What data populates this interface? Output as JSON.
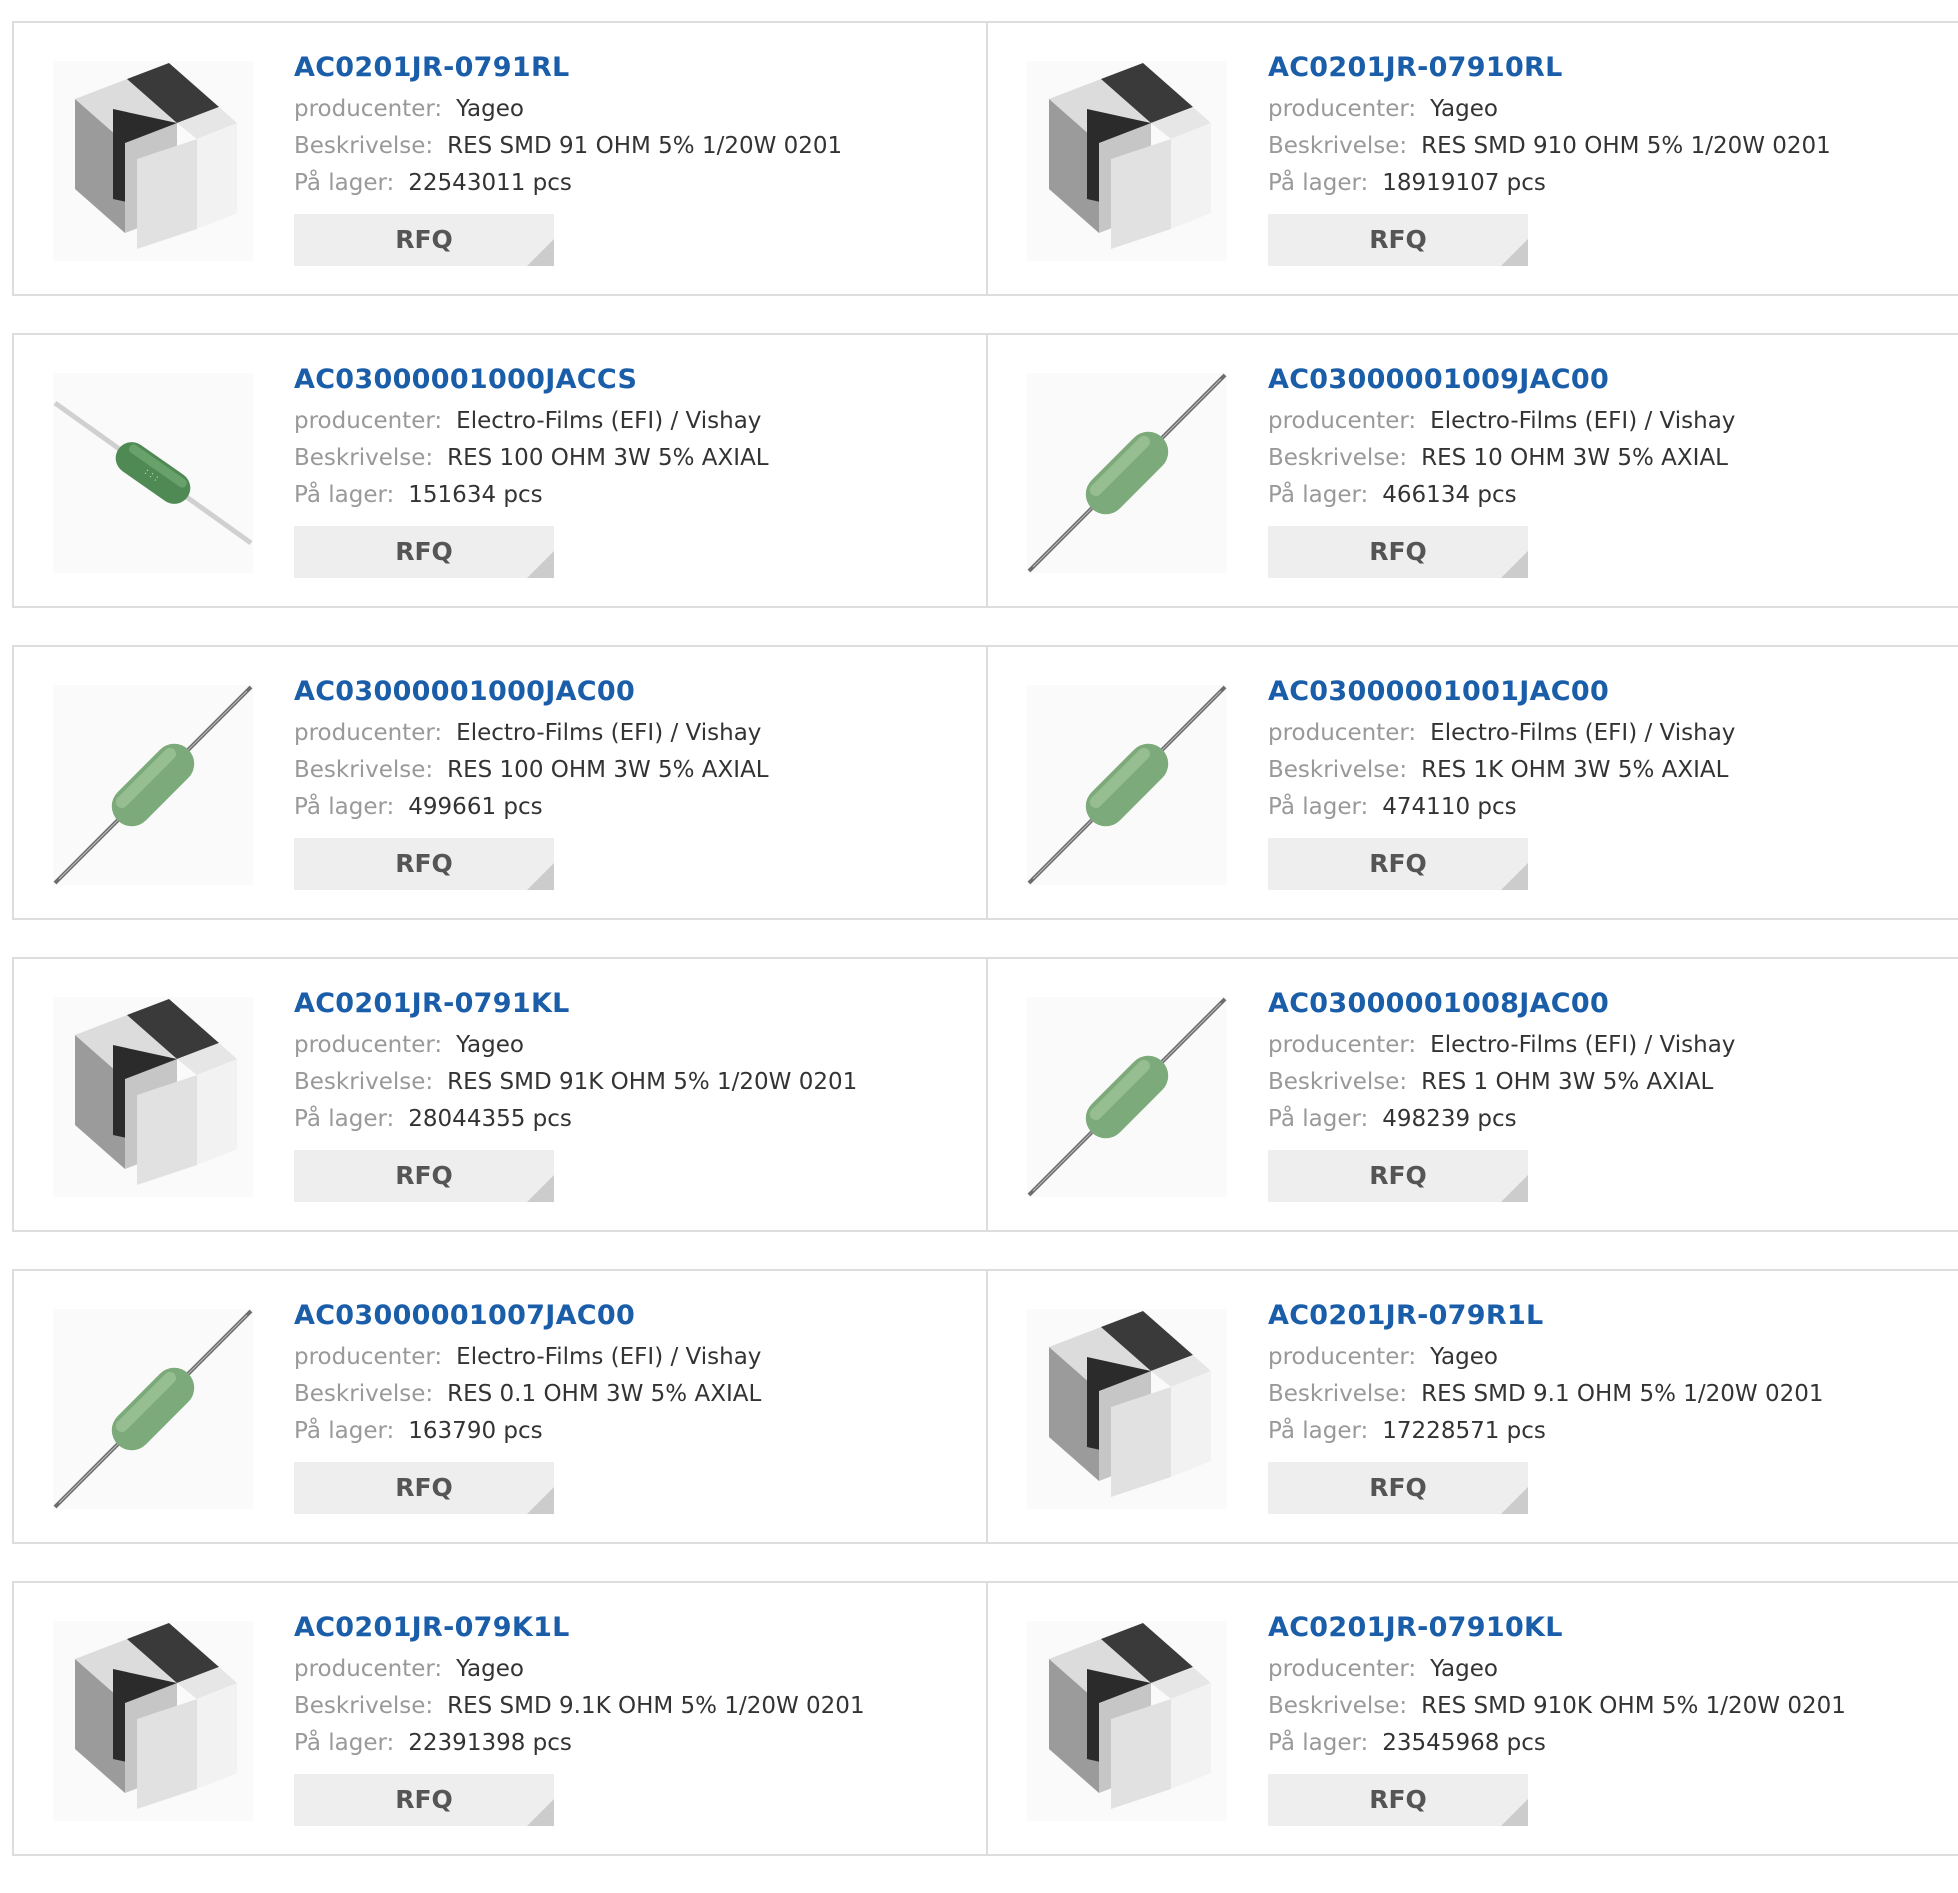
{
  "labels": {
    "manufacturer": "producenter:",
    "description": "Beskrivelse:",
    "stock": "På lager:",
    "rfq": "RFQ"
  },
  "colors": {
    "part_link": "#1a5da8",
    "label": "#999999",
    "value": "#333333",
    "rfq_bg": "#eeeeee",
    "border": "#dddddd"
  },
  "products": [
    {
      "part": "AC0201JR-0791RL",
      "manufacturer": "Yageo",
      "description": "RES SMD 91 OHM 5% 1/20W 0201",
      "stock": "22543011 pcs",
      "image": "chip-resistor-icon"
    },
    {
      "part": "AC0201JR-07910RL",
      "manufacturer": "Yageo",
      "description": "RES SMD 910 OHM 5% 1/20W 0201",
      "stock": "18919107 pcs",
      "image": "chip-resistor-icon"
    },
    {
      "part": "AC03000001000JACCS",
      "manufacturer": "Electro-Films (EFI) / Vishay",
      "description": "RES 100 OHM 3W 5% AXIAL",
      "stock": "151634 pcs",
      "image": "axial-resistor-light-icon"
    },
    {
      "part": "AC03000001009JAC00",
      "manufacturer": "Electro-Films (EFI) / Vishay",
      "description": "RES 10 OHM 3W 5% AXIAL",
      "stock": "466134 pcs",
      "image": "axial-resistor-icon"
    },
    {
      "part": "AC03000001000JAC00",
      "manufacturer": "Electro-Films (EFI) / Vishay",
      "description": "RES 100 OHM 3W 5% AXIAL",
      "stock": "499661 pcs",
      "image": "axial-resistor-icon"
    },
    {
      "part": "AC03000001001JAC00",
      "manufacturer": "Electro-Films (EFI) / Vishay",
      "description": "RES 1K OHM 3W 5% AXIAL",
      "stock": "474110 pcs",
      "image": "axial-resistor-icon"
    },
    {
      "part": "AC0201JR-0791KL",
      "manufacturer": "Yageo",
      "description": "RES SMD 91K OHM 5% 1/20W 0201",
      "stock": "28044355 pcs",
      "image": "chip-resistor-icon"
    },
    {
      "part": "AC03000001008JAC00",
      "manufacturer": "Electro-Films (EFI) / Vishay",
      "description": "RES 1 OHM 3W 5% AXIAL",
      "stock": "498239 pcs",
      "image": "axial-resistor-icon"
    },
    {
      "part": "AC03000001007JAC00",
      "manufacturer": "Electro-Films (EFI) / Vishay",
      "description": "RES 0.1 OHM 3W 5% AXIAL",
      "stock": "163790 pcs",
      "image": "axial-resistor-icon"
    },
    {
      "part": "AC0201JR-079R1L",
      "manufacturer": "Yageo",
      "description": "RES SMD 9.1 OHM 5% 1/20W 0201",
      "stock": "17228571 pcs",
      "image": "chip-resistor-icon"
    },
    {
      "part": "AC0201JR-079K1L",
      "manufacturer": "Yageo",
      "description": "RES SMD 9.1K OHM 5% 1/20W 0201",
      "stock": "22391398 pcs",
      "image": "chip-resistor-icon"
    },
    {
      "part": "AC0201JR-07910KL",
      "manufacturer": "Yageo",
      "description": "RES SMD 910K OHM 5% 1/20W 0201",
      "stock": "23545968 pcs",
      "image": "chip-resistor-icon"
    }
  ]
}
